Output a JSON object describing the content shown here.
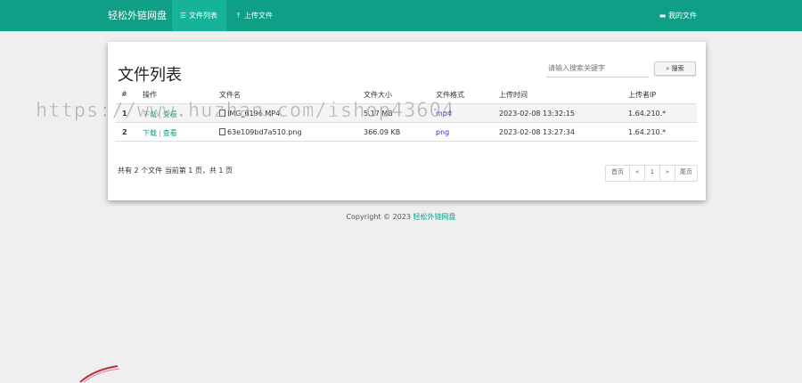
{
  "navbar": {
    "brand": "轻松外链网盘",
    "items": [
      {
        "icon": "list-icon",
        "label": "文件列表",
        "active": true
      },
      {
        "icon": "upload-icon",
        "label": "上传文件",
        "active": false
      }
    ],
    "right_item": {
      "icon": "folder-icon",
      "label": "我的文件"
    }
  },
  "main": {
    "title": "文件列表",
    "search": {
      "placeholder": "请输入搜索关键字",
      "button_label": "搜索"
    },
    "table": {
      "columns": [
        "#",
        "操作",
        "文件名",
        "文件大小",
        "文件格式",
        "上传时间",
        "上传者IP"
      ],
      "rows": [
        {
          "index": "1",
          "download": "下载",
          "view": "查看",
          "filename": "IMG_6196.MP4",
          "size": "5.17 MB",
          "format": "mp4",
          "time": "2023-02-08 13:32:15",
          "ip": "1.64.210.*"
        },
        {
          "index": "2",
          "download": "下载",
          "view": "查看",
          "filename": "63e109bd7a510.png",
          "size": "366.09 KB",
          "format": "png",
          "time": "2023-02-08 13:27:34",
          "ip": "1.64.210.*"
        }
      ]
    },
    "summary": "共有 2 个文件  当前第 1 页，共 1 页",
    "pagination": {
      "first": "首页",
      "prev": "«",
      "current": "1",
      "next": "»",
      "last": "尾页"
    }
  },
  "footer": {
    "copyright": "Copyright © 2023 ",
    "site_name": "轻松外链网盘"
  },
  "watermark": "https://www.huzhan.com/ishop43604",
  "colors": {
    "primary": "#0e9f86",
    "active_nav": "#16b299",
    "background": "#efefef"
  }
}
